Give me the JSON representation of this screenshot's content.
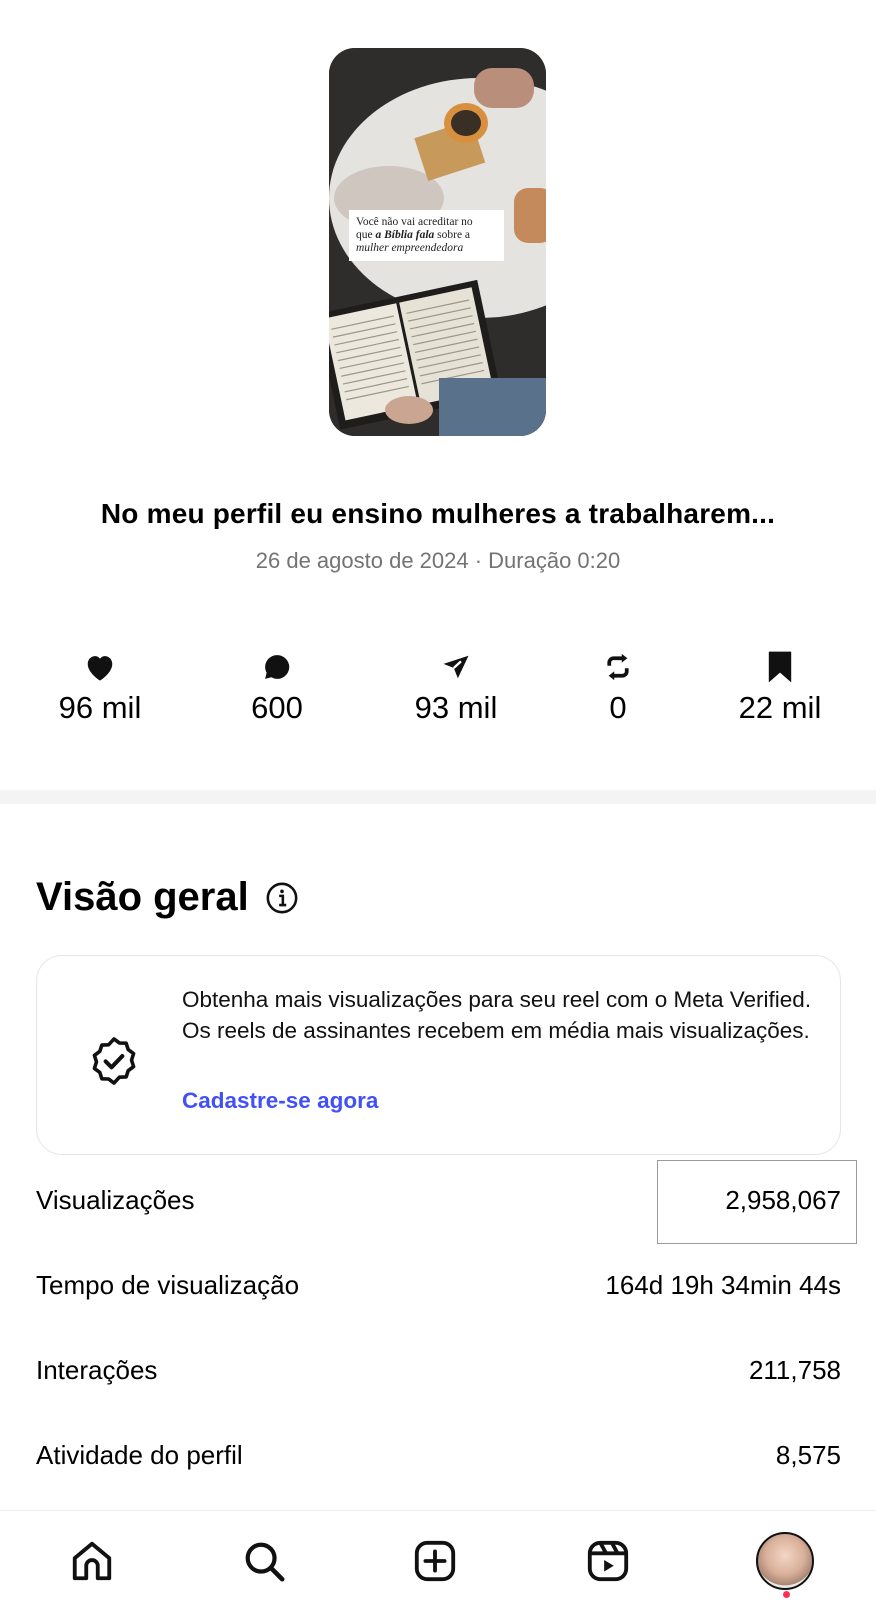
{
  "thumbnail": {
    "caption_line1": "Você não vai acreditar no",
    "caption_line2_prefix": "que ",
    "caption_line2_bold": "a Bíblia fala",
    "caption_line2_suffix": " sobre a",
    "caption_line3": "mulher empreendedora"
  },
  "reel": {
    "title": "No meu perfil eu ensino mulheres a trabalharem...",
    "meta": "26 de agosto de 2024 · Duração 0:20"
  },
  "stats": [
    {
      "icon": "heart-icon",
      "value": "96 mil"
    },
    {
      "icon": "comment-icon",
      "value": "600"
    },
    {
      "icon": "send-icon",
      "value": "93 mil"
    },
    {
      "icon": "repost-icon",
      "value": "0"
    },
    {
      "icon": "bookmark-icon",
      "value": "22 mil"
    }
  ],
  "overview": {
    "title": "Visão geral",
    "promo_text": "Obtenha mais visualizações para seu reel com o Meta Verified. Os reels de assinantes recebem em média mais visualizações.",
    "promo_cta": "Cadastre-se agora",
    "metrics": [
      {
        "label": "Visualizações",
        "value": "2,958,067"
      },
      {
        "label": "Tempo de visualização",
        "value": "164d 19h 34min 44s"
      },
      {
        "label": "Interações",
        "value": "211,758"
      },
      {
        "label": "Atividade do perfil",
        "value": "8,575"
      }
    ]
  },
  "colors": {
    "accent_link": "#4150f7",
    "secondary_text": "#737373",
    "notification": "#ff2e55"
  },
  "nav": [
    "home-icon",
    "search-icon",
    "create-icon",
    "reels-icon",
    "profile-avatar"
  ]
}
